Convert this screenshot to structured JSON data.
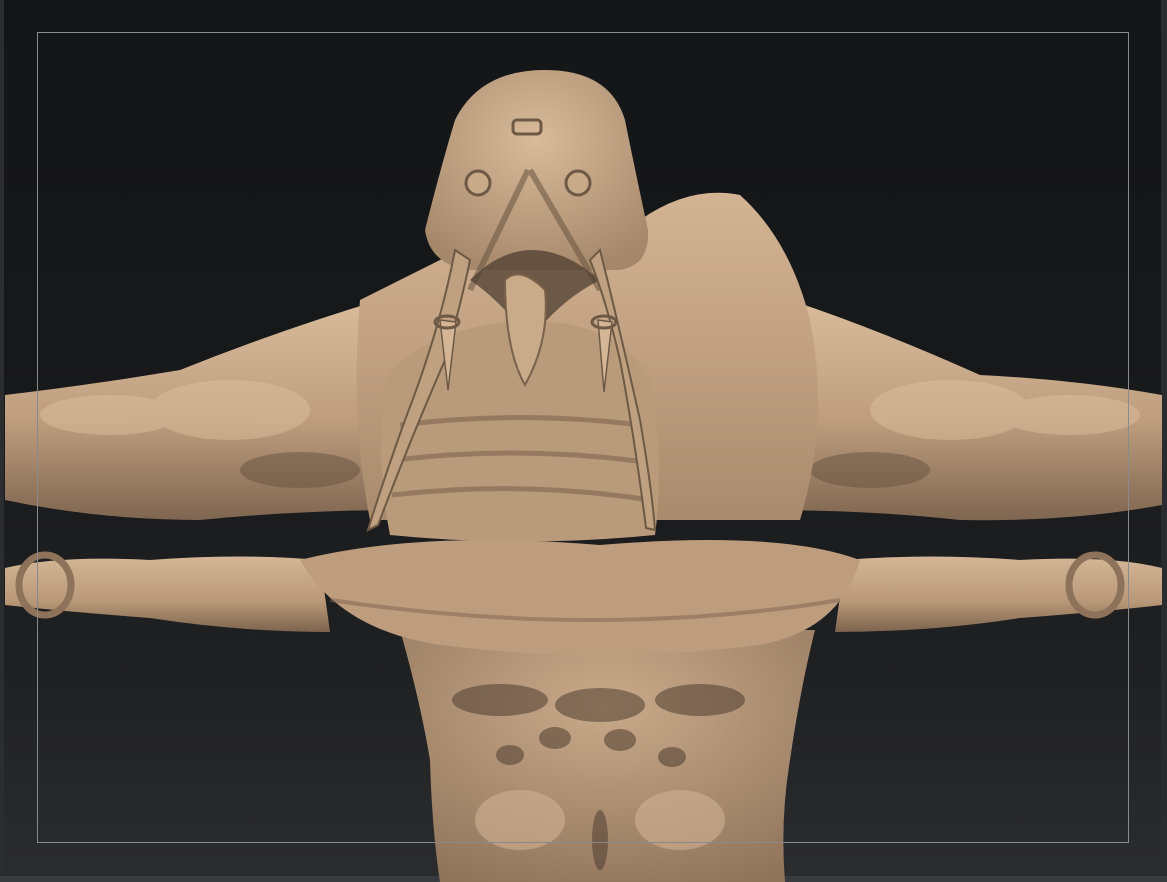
{
  "viewport": {
    "background": "#17181a",
    "frame_color": "#8a8a8a",
    "model_material_color": "#c4a585",
    "model_shadow_color": "#6e5a44",
    "model_highlight_color": "#e2c6a6"
  }
}
